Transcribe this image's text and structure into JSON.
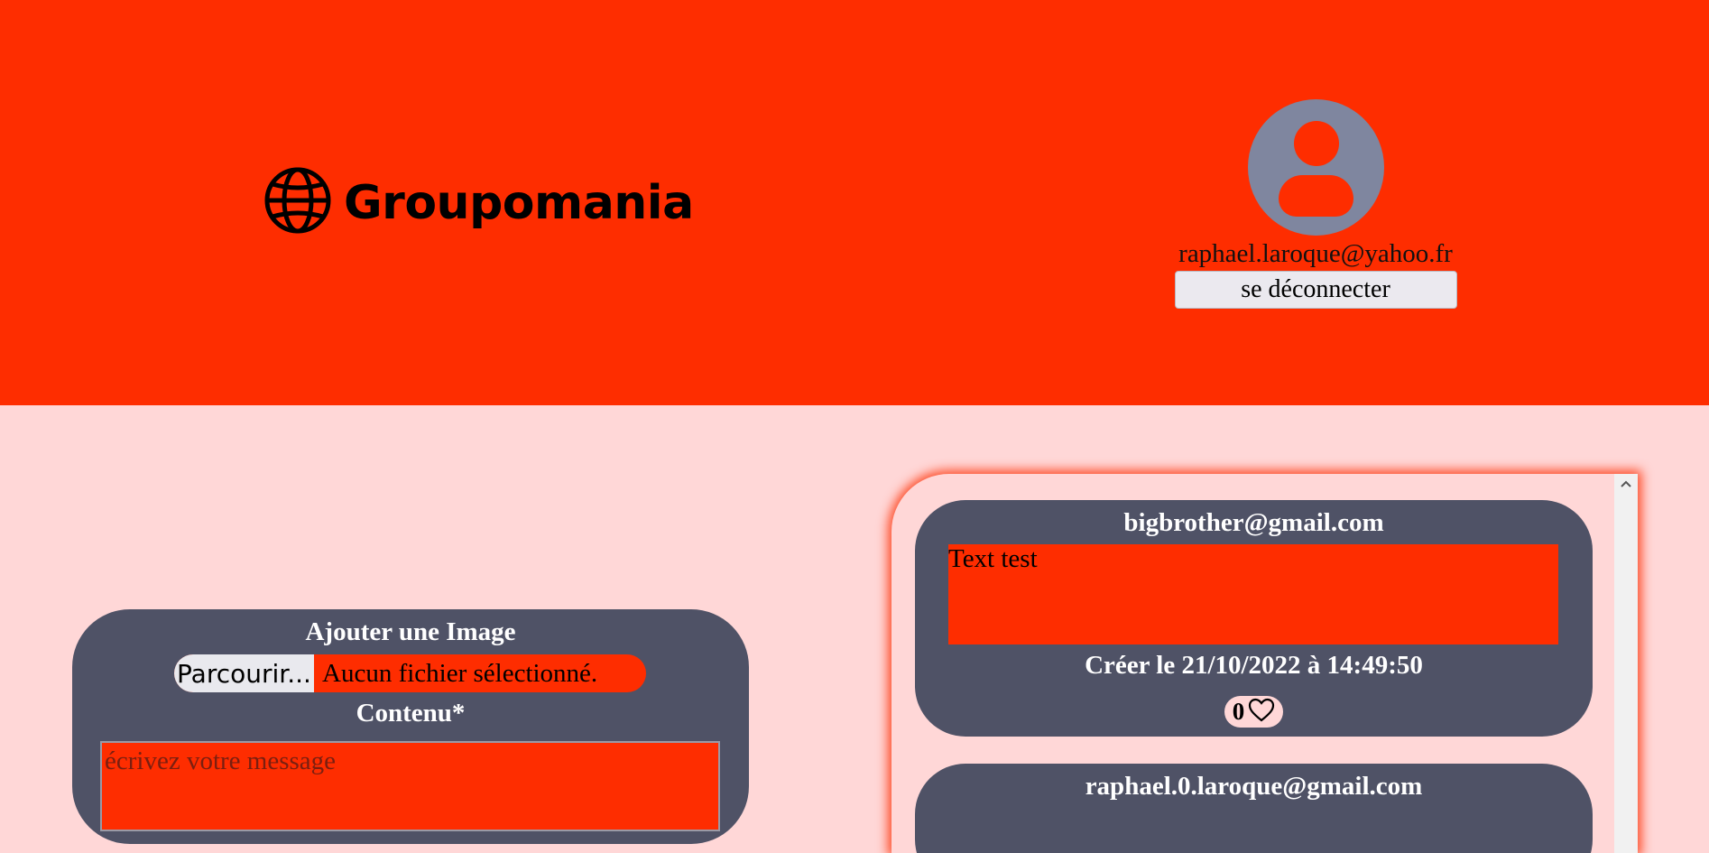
{
  "header": {
    "logo_text": "Groupomania",
    "logo_icon": "globe-icon",
    "user": {
      "avatar_icon": "user-avatar-icon",
      "email": "raphael.laroque@yahoo.fr",
      "logout_label": "se déconnecter"
    }
  },
  "compose": {
    "image_title": "Ajouter une Image",
    "browse_label": "Parcourir...",
    "file_status": "Aucun fichier sélectionné.",
    "content_label": "Contenu*",
    "message_placeholder": "écrivez votre message"
  },
  "feed": {
    "posts": [
      {
        "author": "bigbrother@gmail.com",
        "content": "Text test",
        "date": "Créer le 21/10/2022 à 14:49:50",
        "likes": "0"
      },
      {
        "author": "raphael.0.laroque@gmail.com"
      }
    ]
  },
  "colors": {
    "header_bg": "#fe2d00",
    "page_bg": "#ffd7d7",
    "card_bg": "#4f5266",
    "avatar_bg": "#7f869f"
  }
}
